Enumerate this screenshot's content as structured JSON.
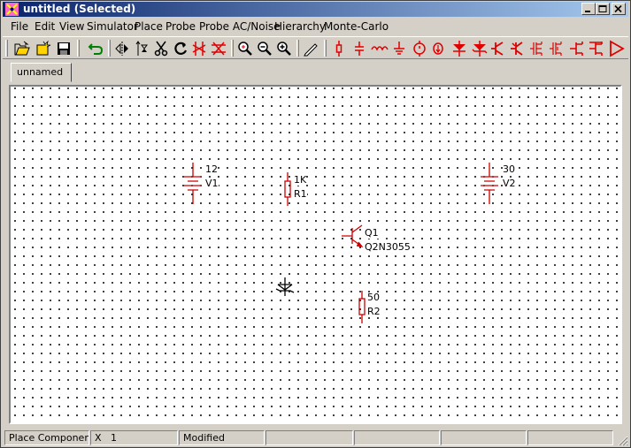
{
  "window": {
    "title": "untitled (Selected)"
  },
  "menu": [
    "File",
    "Edit",
    "View",
    "Simulator",
    "Place",
    "Probe",
    "Probe AC/Noise",
    "Hierarchy",
    "Monte-Carlo"
  ],
  "toolbar": {
    "icons": [
      "open-folder-icon",
      "new-file-icon",
      "save-disk-icon",
      "undo-icon",
      "flip-horizontal-icon",
      "flip-vertical-icon",
      "cut-scissors-icon",
      "rotate-icon",
      "delete-wire-icon",
      "delete-node-icon",
      "zoom-fit-icon",
      "zoom-out-icon",
      "zoom-in-icon",
      "pencil-wire-icon",
      "resistor-icon",
      "capacitor-icon",
      "inductor-icon",
      "ground-icon",
      "voltage-source-icon",
      "current-source-icon",
      "diode-icon",
      "zener-diode-icon",
      "npn-transistor-icon",
      "pnp-transistor-icon",
      "nmos-icon",
      "pmos-icon",
      "njfet-icon",
      "pjfet-icon",
      "opamp-icon"
    ],
    "accent": "#e00000"
  },
  "tabs": [
    {
      "label": "unnamed"
    }
  ],
  "schematic": {
    "components": [
      {
        "kind": "battery",
        "value": "12",
        "ref": "V1"
      },
      {
        "kind": "resistor",
        "value": "1K",
        "ref": "R1"
      },
      {
        "kind": "battery",
        "value": "30",
        "ref": "V2"
      },
      {
        "kind": "npn-transistor",
        "value": "Q1",
        "ref": "Q2N3055"
      },
      {
        "kind": "zener-diode",
        "value": "",
        "ref": ""
      },
      {
        "kind": "resistor",
        "value": "50",
        "ref": "R2"
      }
    ],
    "component_color": "#cc0000"
  },
  "status": {
    "mode": "Place Component",
    "coord_label": "X",
    "coord_value": "1",
    "state": "Modified"
  }
}
